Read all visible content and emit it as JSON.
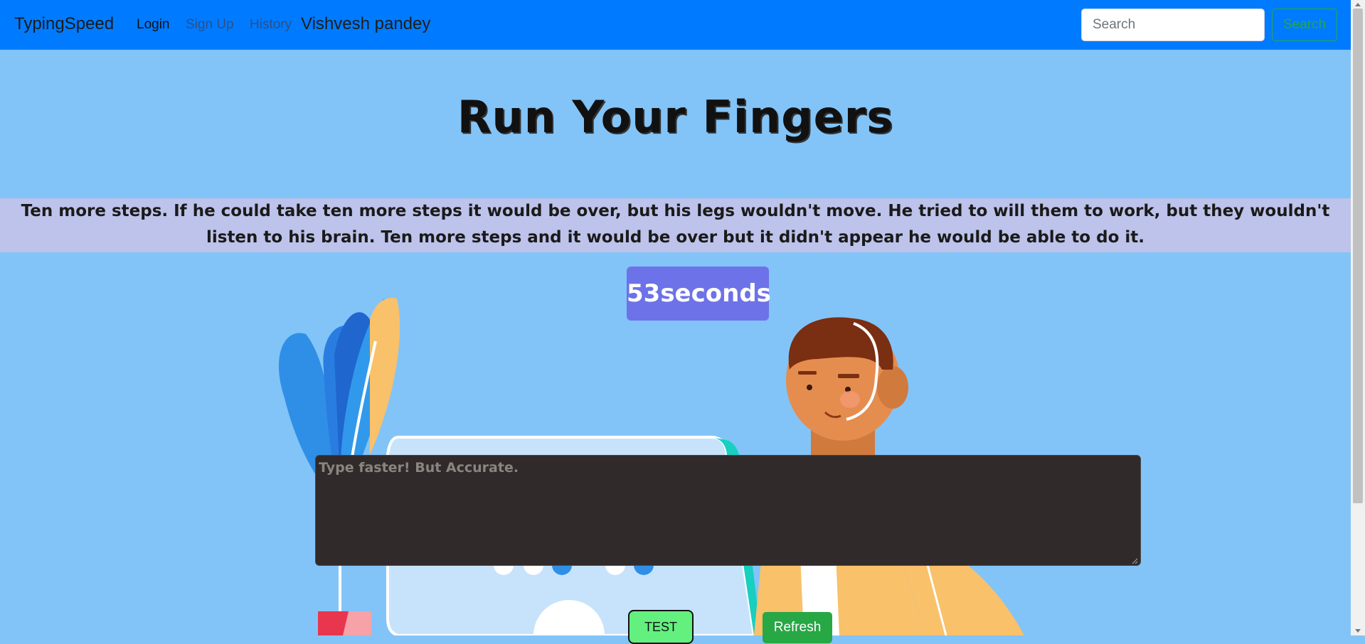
{
  "nav": {
    "brand": "TypingSpeed",
    "links": {
      "login": "Login",
      "signup": "Sign Up",
      "history": "History"
    },
    "user": "Vishvesh pandey",
    "search_placeholder": "Search",
    "search_button": "Search"
  },
  "main": {
    "heading": "Run Your Fingers",
    "paragraph": "Ten more steps. If he could take ten more steps it would be over, but his legs wouldn't move. He tried to will them to work, but they wouldn't listen to his brain. Ten more steps and it would be over but it didn't appear he would be able to do it.",
    "timer": "53seconds",
    "textarea_placeholder": "Type faster! But Accurate.",
    "test_button": "TEST",
    "refresh_button": "Refresh"
  },
  "colors": {
    "background": "#82c4f8",
    "navbar": "#007bff",
    "timer": "#6d72e8",
    "paragraph_band": "#bdc3ea",
    "textarea": "#312a2a",
    "test_button": "#63f07f",
    "refresh_button": "#28a745"
  }
}
